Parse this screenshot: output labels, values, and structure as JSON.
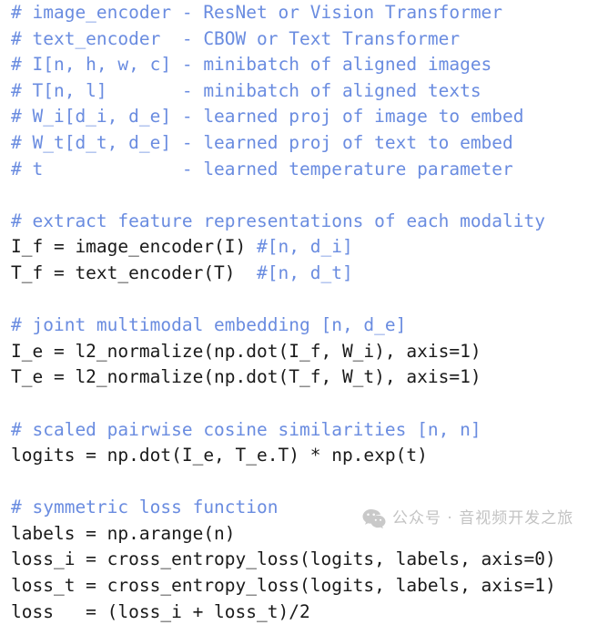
{
  "listing": {
    "language": "python",
    "colors": {
      "background": "#ffffff",
      "comment": "#6a8ce0",
      "code": "#1a1a1a",
      "watermark": "#c3c3c3"
    },
    "lines": [
      {
        "kind": "comment",
        "text": "# image_encoder - ResNet or Vision Transformer"
      },
      {
        "kind": "comment",
        "text": "# text_encoder  - CBOW or Text Transformer"
      },
      {
        "kind": "comment",
        "text": "# I[n, h, w, c] - minibatch of aligned images"
      },
      {
        "kind": "comment",
        "text": "# T[n, l]       - minibatch of aligned texts"
      },
      {
        "kind": "comment",
        "text": "# W_i[d_i, d_e] - learned proj of image to embed"
      },
      {
        "kind": "comment",
        "text": "# W_t[d_t, d_e] - learned proj of text to embed"
      },
      {
        "kind": "comment",
        "text": "# t             - learned temperature parameter"
      },
      {
        "kind": "blank",
        "text": " "
      },
      {
        "kind": "comment",
        "text": "# extract feature representations of each modality"
      },
      {
        "kind": "mixed",
        "code": "I_f = image_encoder(I) ",
        "comment": "#[n, d_i]"
      },
      {
        "kind": "mixed",
        "code": "T_f = text_encoder(T)  ",
        "comment": "#[n, d_t]"
      },
      {
        "kind": "blank",
        "text": " "
      },
      {
        "kind": "comment",
        "text": "# joint multimodal embedding [n, d_e]"
      },
      {
        "kind": "code",
        "text": "I_e = l2_normalize(np.dot(I_f, W_i), axis=1)"
      },
      {
        "kind": "code",
        "text": "T_e = l2_normalize(np.dot(T_f, W_t), axis=1)"
      },
      {
        "kind": "blank",
        "text": " "
      },
      {
        "kind": "comment",
        "text": "# scaled pairwise cosine similarities [n, n]"
      },
      {
        "kind": "code",
        "text": "logits = np.dot(I_e, T_e.T) * np.exp(t)"
      },
      {
        "kind": "blank",
        "text": " "
      },
      {
        "kind": "comment",
        "text": "# symmetric loss function"
      },
      {
        "kind": "code",
        "text": "labels = np.arange(n)"
      },
      {
        "kind": "code",
        "text": "loss_i = cross_entropy_loss(logits, labels, axis=0)"
      },
      {
        "kind": "code",
        "text": "loss_t = cross_entropy_loss(logits, labels, axis=1)"
      },
      {
        "kind": "code",
        "text": "loss   = (loss_i + loss_t)/2"
      }
    ]
  },
  "watermark": {
    "icon": "wechat-icon",
    "text": "公众号 · 音视频开发之旅"
  }
}
